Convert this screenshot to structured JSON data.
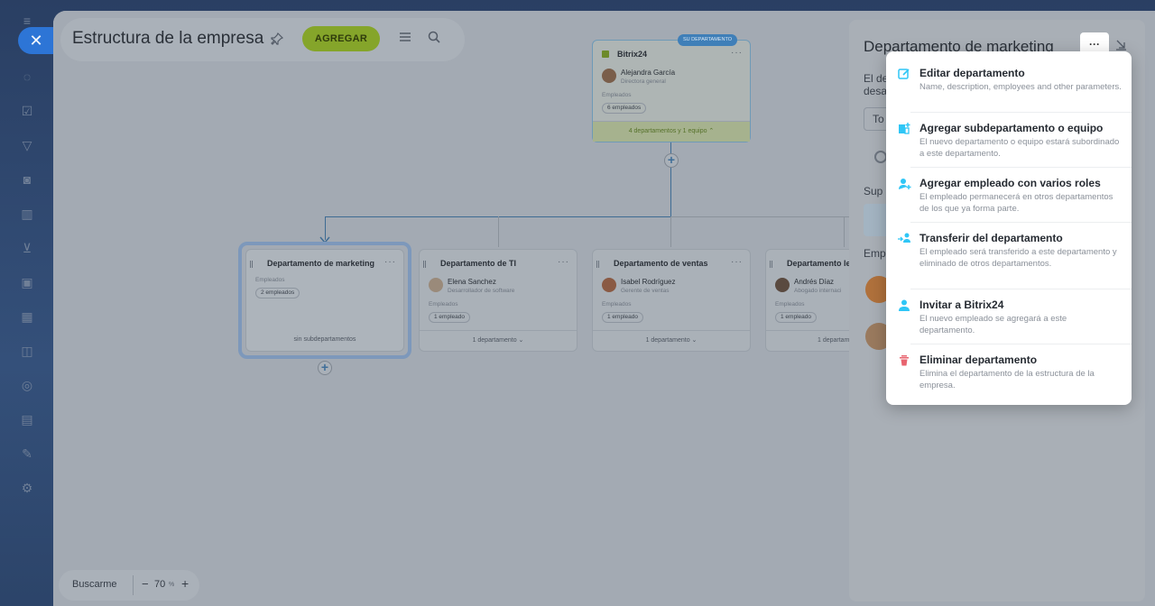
{
  "app": {
    "title": "Estructura de la empresa",
    "add_label": "AGREGAR",
    "close_label": "✕"
  },
  "colors": {
    "accent": "#2d75d6",
    "add_button": "#a8d13a",
    "delete_icon": "#e8646f",
    "menu_icon": "#2fc6f6"
  },
  "root": {
    "badge": "SU DEPARTAMENTO",
    "name": "Bitrix24",
    "head_name": "Alejandra García",
    "head_role": "Directora general",
    "employees_label": "Empleados",
    "employees_count": "6 empleados",
    "footer": "4 departamentos y 1 equipo ⌃"
  },
  "departments": [
    {
      "name": "Departamento de marketing",
      "employees_label": "Empleados",
      "employees_count": "2 empleados",
      "footer": "sin subdepartamentos"
    },
    {
      "name": "Departamento de TI",
      "head_name": "Elena Sanchez",
      "head_role": "Desarrollador de software",
      "employees_label": "Empleados",
      "employees_count": "1 empleado",
      "footer": "1 departamento ⌄"
    },
    {
      "name": "Departamento de ventas",
      "head_name": "Isabel Rodríguez",
      "head_role": "Gerente de ventas",
      "employees_label": "Empleados",
      "employees_count": "1 empleado",
      "footer": "1 departamento ⌄"
    },
    {
      "name": "Departamento le",
      "head_name": "Andrés Díaz",
      "head_role": "Abogado internaci",
      "employees_label": "Empleados",
      "employees_count": "1 empleado",
      "footer": "1 departam"
    }
  ],
  "card_menu": "···",
  "bottom_bar": {
    "find_me": "Buscarme",
    "minus": "−",
    "zoom": "70",
    "unit": "%",
    "plus": "+"
  },
  "panel": {
    "title": "Departamento de marketing",
    "more": "···",
    "fragments": {
      "line1": "El de",
      "line2": "desa",
      "input": "To",
      "section1": "Sup",
      "section2": "Emp"
    }
  },
  "menu": [
    {
      "icon": "edit-icon",
      "title": "Editar departamento",
      "desc": "Name, description, employees and other parameters."
    },
    {
      "icon": "add-subdepartment-icon",
      "title": "Agregar subdepartamento o equipo",
      "desc": "El nuevo departamento o equipo estará subordinado a este departamento."
    },
    {
      "icon": "add-employee-icon",
      "title": "Agregar empleado con varios roles",
      "desc": "El empleado permanecerá en otros departamentos de los que ya forma parte."
    },
    {
      "icon": "transfer-icon",
      "title": "Transferir del departamento",
      "desc": "El empleado será transferido a este departamento y eliminado de otros departamentos."
    },
    {
      "icon": "invite-icon",
      "title": "Invitar a Bitrix24",
      "desc": "El nuevo empleado se agregará a este departamento."
    },
    {
      "icon": "trash-icon",
      "title": "Eliminar departamento",
      "desc": "Elimina el departamento de la estructura de la empresa."
    }
  ]
}
